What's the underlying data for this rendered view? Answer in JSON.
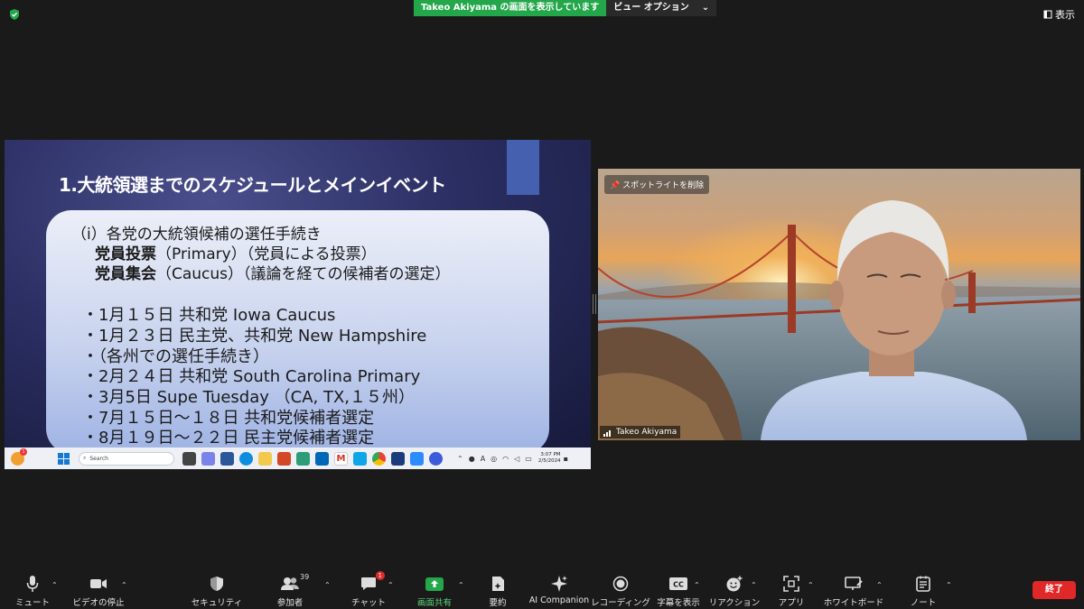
{
  "topbar": {
    "share_label": "Takeo  Akiyama の画面を表示しています",
    "view_options": "ビュー オプション",
    "view_chevron": "⌄",
    "display_label": "表示"
  },
  "slide": {
    "title": "1.大統領選までのスケジュールとメインイベント",
    "lines": [
      "（i）各党の大統領候補の選任手続き",
      "党員投票",
      "（Primary）（党員による投票）",
      "党員集会",
      "（Caucus）（議論を経ての候補者の選定）",
      "・1月１５日  共和党  Iowa Caucus",
      "・1月２３日  民主党、共和党  New Hampshire",
      "・（各州での選任手続き）",
      "・2月２４日  共和党  South Carolina Primary",
      "・3月5日  Supe Tuesday （CA, TX,１５州）",
      "・7月１５日～１８日  共和党候補者選定",
      "・8月１９日～２２日  民主党候補者選定"
    ]
  },
  "taskbar": {
    "search_placeholder": "Search",
    "time": "3:07 PM",
    "date": "2/5/2024",
    "notif_count": "1",
    "tray_a": "A"
  },
  "video": {
    "spotlight_label": "スポットライトを削除",
    "participant_name": "Takeo Akiyama"
  },
  "toolbar": {
    "mute": "ミュート",
    "stop_video": "ビデオの停止",
    "security": "セキュリティ",
    "participants": "参加者",
    "participant_count": "39",
    "chat": "チャット",
    "chat_badge": "1",
    "share_screen": "画面共有",
    "summary": "要約",
    "ai_companion": "AI Companion",
    "recording": "レコーディング",
    "captions": "字幕を表示",
    "reactions": "リアクション",
    "apps": "アプリ",
    "whiteboard": "ホワイトボード",
    "notes": "ノート",
    "end": "終了",
    "cc_text": "CC"
  },
  "colors": {
    "share_green": "#23a74a",
    "end_red": "#e02828",
    "toolbar_bg": "#1a1a1a"
  }
}
